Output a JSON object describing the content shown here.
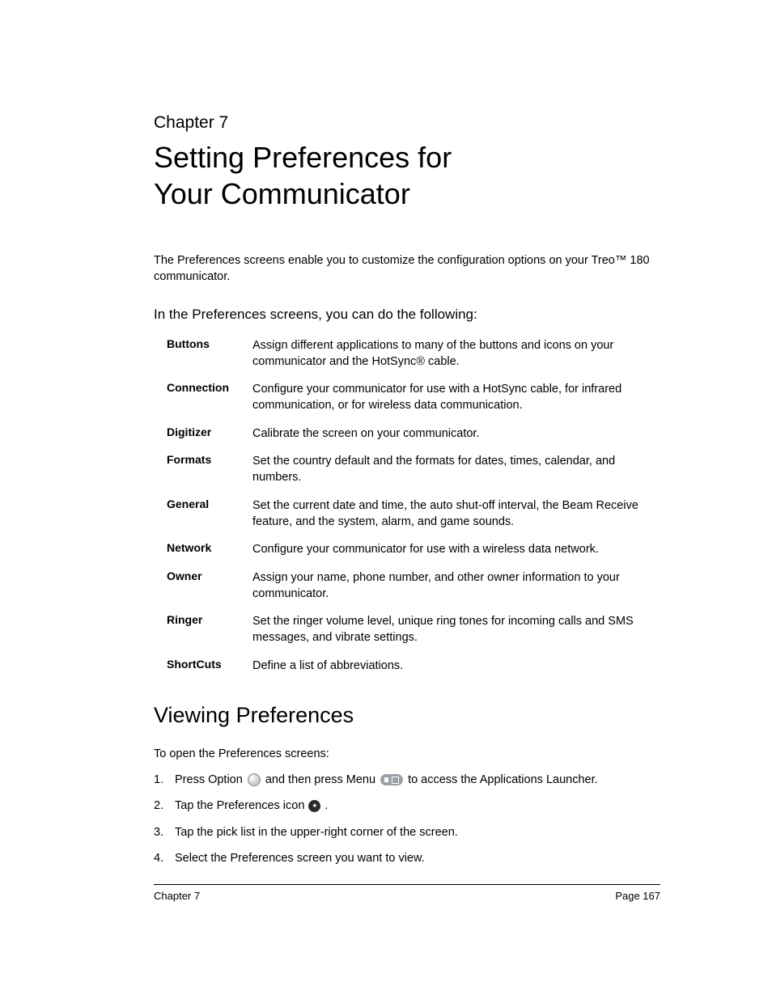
{
  "chapter_label": "Chapter 7",
  "chapter_title_line1": "Setting Preferences for",
  "chapter_title_line2": "Your Communicator",
  "intro": "The Preferences screens enable you to customize the configuration options on your Treo™ 180 communicator.",
  "subhead": "In the Preferences screens, you can do the following:",
  "prefs": [
    {
      "term": "Buttons",
      "desc": "Assign different applications to many of the buttons and icons on your communicator and the HotSync® cable."
    },
    {
      "term": "Connection",
      "desc": "Configure your communicator for use with a HotSync cable, for infrared communication, or for wireless data communication."
    },
    {
      "term": "Digitizer",
      "desc": "Calibrate the screen on your communicator."
    },
    {
      "term": "Formats",
      "desc": "Set the country default and the formats for dates, times, calendar, and numbers."
    },
    {
      "term": "General",
      "desc": "Set the current date and time, the auto shut-off interval, the Beam Receive feature, and the system, alarm, and game sounds."
    },
    {
      "term": "Network",
      "desc": "Configure your communicator for use with a wireless data network."
    },
    {
      "term": "Owner",
      "desc": "Assign your name, phone number, and other owner information to your communicator."
    },
    {
      "term": "Ringer",
      "desc": "Set the ringer volume level, unique ring tones for incoming calls and SMS messages, and vibrate settings."
    },
    {
      "term": "ShortCuts",
      "desc": "Define a list of abbreviations."
    }
  ],
  "section_heading": "Viewing Preferences",
  "steps_heading": "To open the Preferences screens:",
  "steps": {
    "s1a": "Press Option",
    "s1b": "and then press Menu",
    "s1c": "to access the Applications Launcher.",
    "s2a": "Tap the Preferences icon",
    "s2b": ".",
    "s3": "Tap the pick list in the upper-right corner of the screen.",
    "s4": "Select the Preferences screen you want to view."
  },
  "footer_left": "Chapter 7",
  "footer_right": "Page 167"
}
